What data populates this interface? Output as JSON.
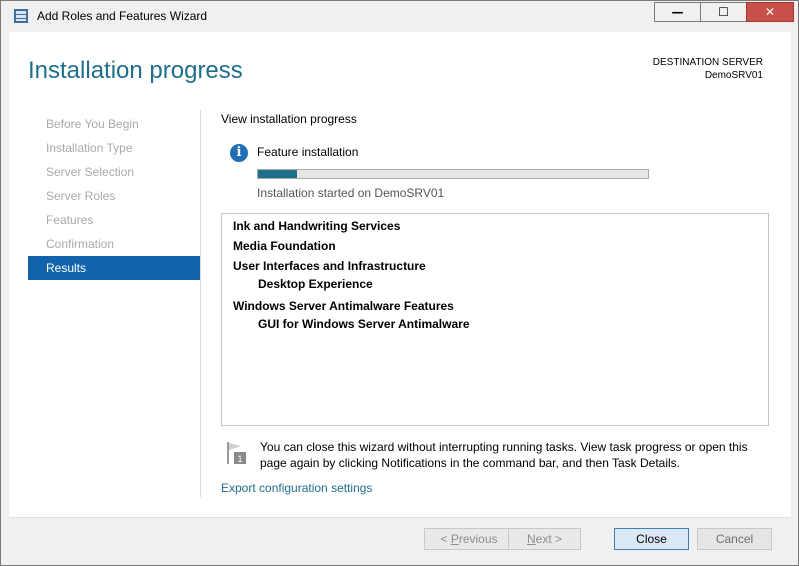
{
  "window": {
    "title": "Add Roles and Features Wizard",
    "controls": {
      "minimize": "—",
      "maximize": "☐",
      "close": "✕"
    }
  },
  "header": {
    "page_title": "Installation progress",
    "destination_label": "DESTINATION SERVER",
    "destination_server": "DemoSRV01"
  },
  "nav": {
    "items": [
      {
        "label": "Before You Begin",
        "state": "disabled"
      },
      {
        "label": "Installation Type",
        "state": "disabled"
      },
      {
        "label": "Server Selection",
        "state": "disabled"
      },
      {
        "label": "Server Roles",
        "state": "disabled"
      },
      {
        "label": "Features",
        "state": "disabled"
      },
      {
        "label": "Confirmation",
        "state": "disabled"
      },
      {
        "label": "Results",
        "state": "active"
      }
    ]
  },
  "main": {
    "view_label": "View installation progress",
    "status_title": "Feature installation",
    "progress_fraction": 0.1,
    "status_detail": "Installation started on DemoSRV01",
    "features": [
      {
        "label": "Ink and Handwriting Services",
        "level": 0
      },
      {
        "label": "Media Foundation",
        "level": 0
      },
      {
        "label": "User Interfaces and Infrastructure",
        "level": 0
      },
      {
        "label": "Desktop Experience",
        "level": 1
      },
      {
        "label": "Windows Server Antimalware Features",
        "level": 0
      },
      {
        "label": "GUI for Windows Server Antimalware",
        "level": 1
      }
    ],
    "note": "You can close this wizard without interrupting running tasks. View task progress or open this page again by clicking Notifications in the command bar, and then Task Details.",
    "export_link": "Export configuration settings"
  },
  "footer": {
    "previous": {
      "prefix": "< ",
      "accel": "P",
      "rest": "revious"
    },
    "next": {
      "accel": "N",
      "rest": "ext >"
    },
    "close": "Close",
    "cancel": "Cancel"
  },
  "colors": {
    "accent": "#1f6f8c",
    "nav_active": "#1164a9",
    "info_icon": "#1e6fb5",
    "close_button": "#c7504a"
  }
}
